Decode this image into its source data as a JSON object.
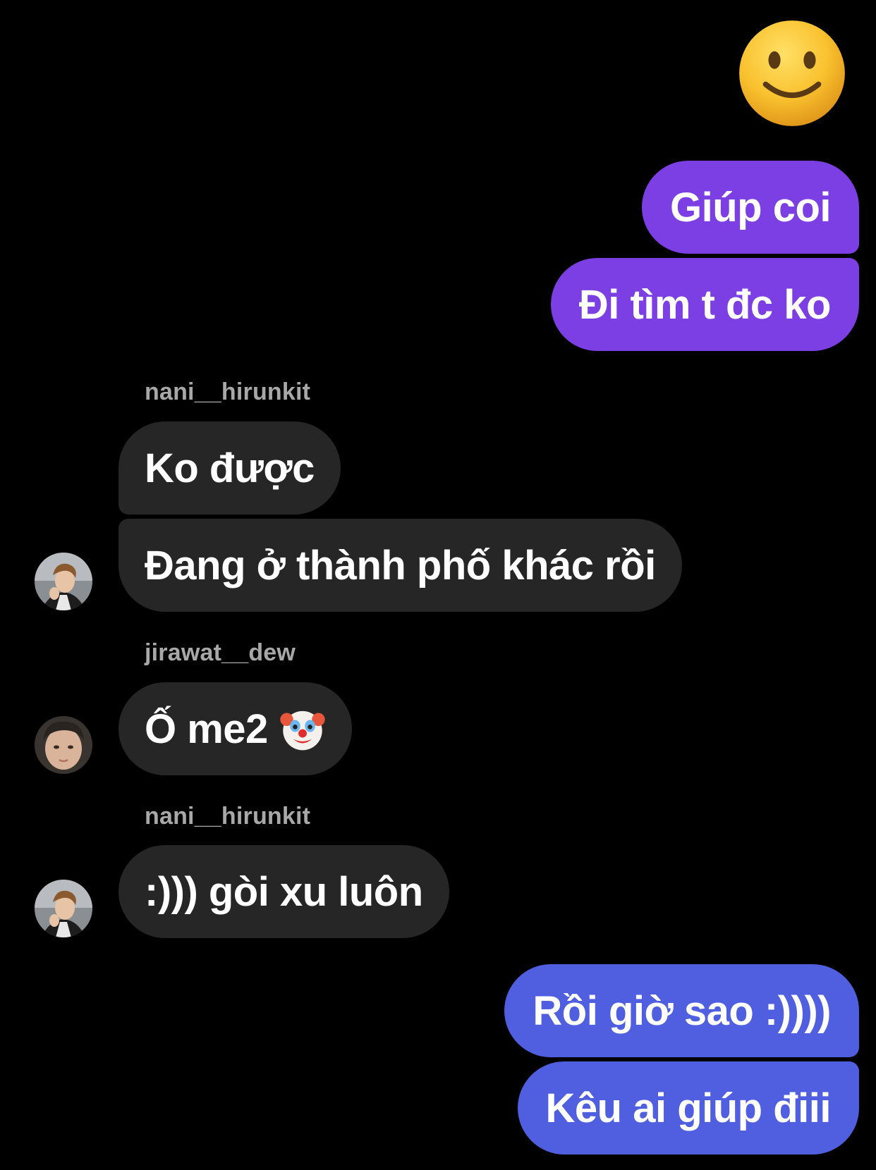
{
  "reaction_emoji": "slightly-smiling-face",
  "messages": [
    {
      "text": "Giúp coi",
      "color": "#7B3FE4"
    },
    {
      "text": "Đi tìm t đc ko",
      "color": "#7B3FE4"
    },
    {
      "sender": "nani__hirunkit"
    },
    {
      "text": "Ko được"
    },
    {
      "text": "Đang ở thành phố khác rồi"
    },
    {
      "sender": "jirawat__dew"
    },
    {
      "text": "Ố me2",
      "emoji": "clown-face"
    },
    {
      "sender": "nani__hirunkit"
    },
    {
      "text": ":))) gòi xu luôn"
    },
    {
      "text": "Rồi giờ sao :))))",
      "color": "#4F5FE0"
    },
    {
      "text": "Kêu ai giúp điii",
      "color": "#4F5FE0"
    }
  ],
  "colors": {
    "background": "#000000",
    "incoming_bubble": "#262626",
    "sender_name": "#A8A8A8",
    "outgoing_purple": "#7B3FE4",
    "outgoing_blue": "#4F5FE0"
  }
}
